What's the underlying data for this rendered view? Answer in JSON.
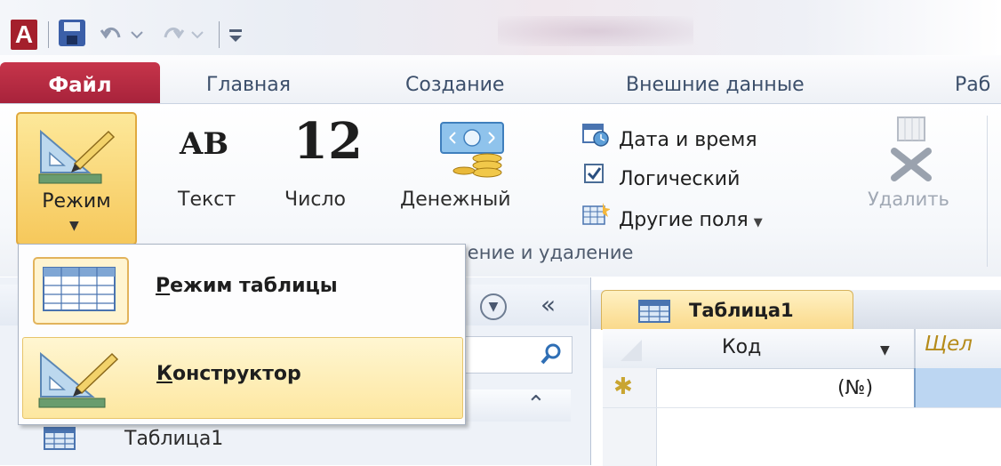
{
  "title_bar": {
    "app_icon": "access-logo",
    "app_letter": "A",
    "quick_access": [
      "save-icon",
      "undo-icon",
      "redo-icon",
      "customize-icon"
    ]
  },
  "ribbon_tabs": {
    "file": "Файл",
    "home": "Главная",
    "create": "Создание",
    "external": "Внешние данные",
    "db_tools_partial": "Раб"
  },
  "ribbon": {
    "mode_label": "Режим",
    "text": {
      "glyph": "AB",
      "label": "Текст"
    },
    "number": {
      "glyph": "12",
      "label": "Число"
    },
    "currency": {
      "label": "Денежный"
    },
    "datetime": "Дата и время",
    "boolean": "Логический",
    "other_fields": "Другие поля",
    "delete": "Удалить",
    "group_label": "вление и удаление"
  },
  "mode_menu": {
    "items": [
      {
        "prefix": "Р",
        "rest": "ежим таблицы",
        "icon": "datasheet-view-icon"
      },
      {
        "prefix": "К",
        "rest": "онструктор",
        "icon": "design-view-icon"
      }
    ],
    "highlighted_index": 1
  },
  "nav_pane": {
    "items": [
      "Таблица1"
    ]
  },
  "document": {
    "tab_label": "Таблица1",
    "columns": [
      "Код",
      "Щел"
    ],
    "new_row_value": "(№)"
  },
  "colors": {
    "access_red": "#a4202c",
    "file_tab": "#b52b42",
    "highlight_gold": "#fde7a0",
    "selection_blue": "#bcd6f2"
  }
}
